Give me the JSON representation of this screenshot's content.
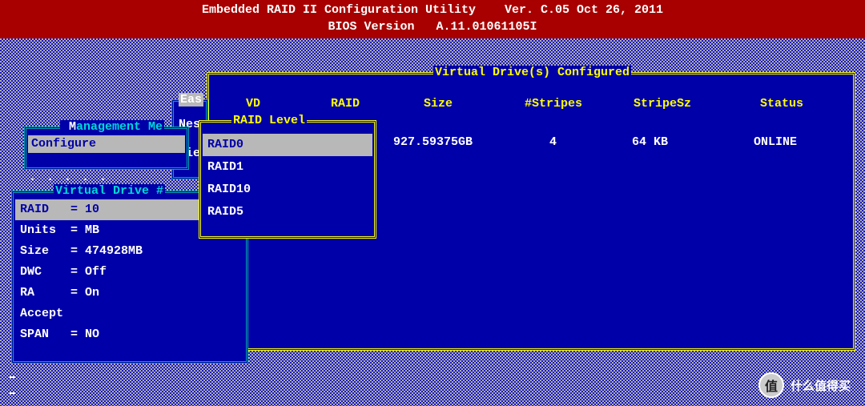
{
  "header": {
    "line1": "Embedded RAID II Configuration Utility    Ver. C.05 Oct 26, 2011",
    "line2": "BIOS Version   A.11.01061105I"
  },
  "panels": {
    "eas": {
      "title_frag": "Eas"
    },
    "nes": {
      "title_frag": "Nes"
    },
    "vie": {
      "title_frag": "Vie"
    },
    "mgmt": {
      "title": " Management Me",
      "items": [
        "Configure"
      ]
    },
    "vdnum": {
      "title": "Virtual Drive #"
    },
    "dots": ". . . . ."
  },
  "vd_params": {
    "rows": [
      {
        "label": "RAID",
        "eq": "=",
        "value": "10",
        "selected": true
      },
      {
        "label": "Units",
        "eq": "=",
        "value": "MB",
        "selected": false
      },
      {
        "label": "Size",
        "eq": "=",
        "value": "474928MB",
        "selected": false
      },
      {
        "label": "DWC",
        "eq": "=",
        "value": "Off",
        "selected": false
      },
      {
        "label": "RA",
        "eq": "=",
        "value": "On",
        "selected": false
      },
      {
        "label": "Accept",
        "eq": "",
        "value": "",
        "selected": false
      },
      {
        "label": "SPAN",
        "eq": "=",
        "value": "NO",
        "selected": false
      }
    ]
  },
  "configured": {
    "title": "Virtual Drive(s) Configured",
    "columns": [
      "VD",
      "RAID",
      "Size",
      "#Stripes",
      "StripeSz",
      "Status"
    ],
    "rows": [
      {
        "vd": "",
        "raid": "",
        "size": "927.59375GB",
        "stripes": "4",
        "stripesz": "64  KB",
        "status": "ONLINE"
      }
    ]
  },
  "raid_level": {
    "title": "RAID Level",
    "options": [
      "RAID0",
      "RAID1",
      "RAID10",
      "RAID5"
    ],
    "selected": 0
  },
  "watermark": {
    "icon": "值",
    "text": "什么值得买"
  }
}
